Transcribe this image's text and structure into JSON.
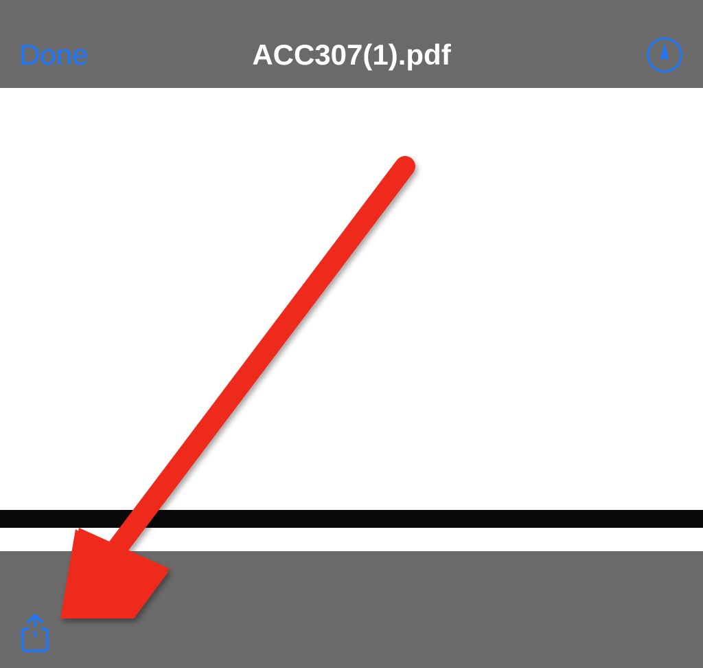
{
  "navbar": {
    "done_label": "Done",
    "title": "ACC307(1).pdf"
  },
  "colors": {
    "accent": "#1a77ff",
    "toolbar_bg": "#6a6a6a",
    "annotation": "#ee2a1b"
  },
  "icons": {
    "markup": "markup-pen-icon",
    "share": "share-icon"
  }
}
